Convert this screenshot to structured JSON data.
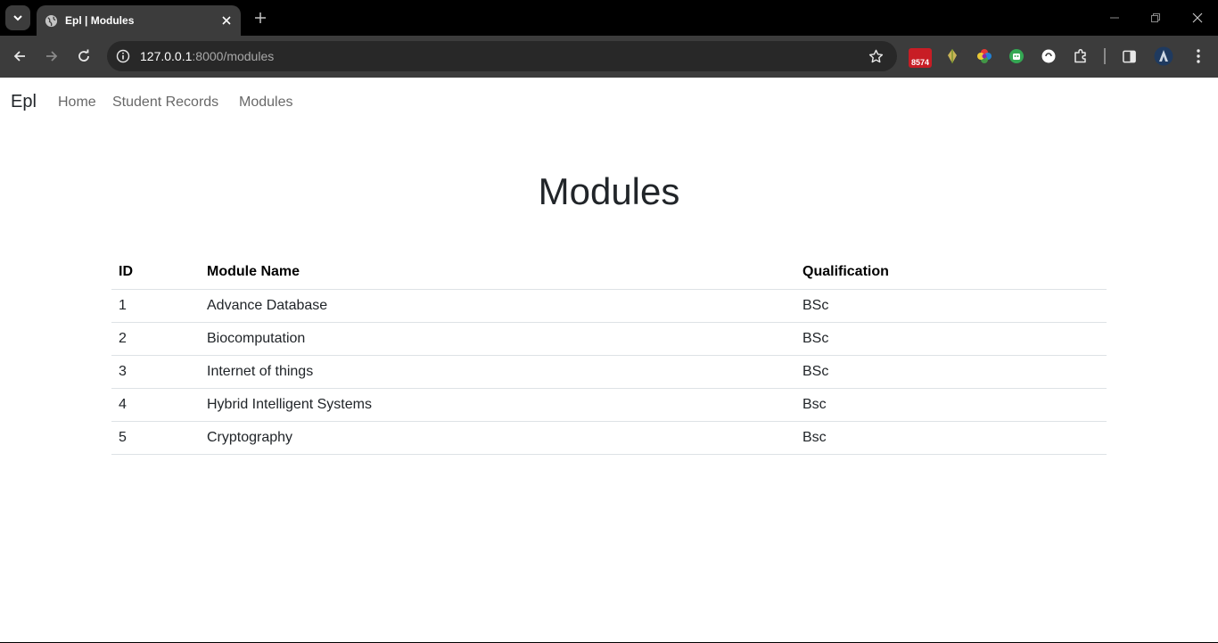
{
  "browser": {
    "tab_title": "Epl | Modules",
    "url_host": "127.0.0.1",
    "url_rest": ":8000/modules",
    "extension_badge": "8574"
  },
  "navbar": {
    "brand": "Epl",
    "links": [
      "Home",
      "Student Records",
      "Modules"
    ]
  },
  "main": {
    "title": "Modules",
    "table": {
      "headers": [
        "ID",
        "Module Name",
        "Qualification"
      ],
      "rows": [
        [
          "1",
          "Advance Database",
          "BSc"
        ],
        [
          "2",
          "Biocomputation",
          "BSc"
        ],
        [
          "3",
          "Internet of things",
          "BSc"
        ],
        [
          "4",
          "Hybrid Intelligent Systems",
          "Bsc"
        ],
        [
          "5",
          "Cryptography",
          "Bsc"
        ]
      ]
    }
  },
  "icons": {
    "tab_search": "chevron-down-icon",
    "favicon": "globe-icon",
    "tab_close": "close-icon",
    "new_tab": "plus-icon",
    "back": "back-arrow-icon",
    "forward": "forward-arrow-icon",
    "reload": "reload-icon",
    "site_info": "info-icon",
    "bookmark": "star-icon",
    "extensions": "puzzle-icon",
    "side_panel": "side-panel-icon",
    "profile": "avatar",
    "menu": "more-vert-icon"
  },
  "colors": {
    "chrome_frame": "#000000",
    "toolbar": "#3c3c3c",
    "omnibox": "#282828",
    "page_background": "#ffffff",
    "text": "#212529",
    "nav_link": "#6c757d",
    "badge": "#c81d25"
  }
}
